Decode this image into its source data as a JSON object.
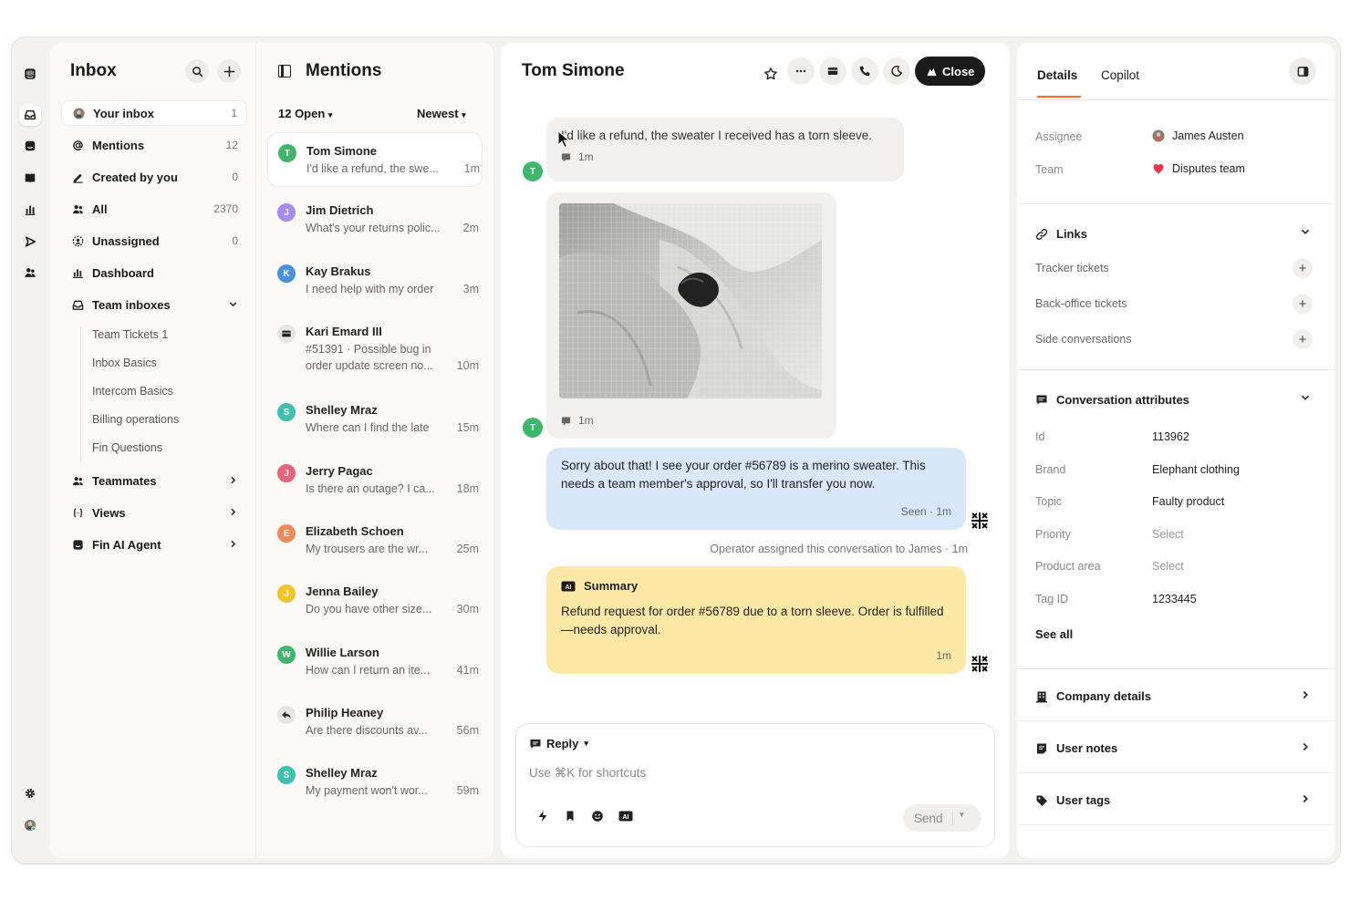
{
  "inbox": {
    "title": "Inbox",
    "nav": [
      {
        "label": "Your inbox",
        "count": "1"
      },
      {
        "label": "Mentions",
        "count": "12"
      },
      {
        "label": "Created by you",
        "count": "0"
      },
      {
        "label": "All",
        "count": "2370"
      },
      {
        "label": "Unassigned",
        "count": "0"
      },
      {
        "label": "Dashboard",
        "count": ""
      },
      {
        "label": "Team inboxes",
        "count": ""
      }
    ],
    "team_inboxes": [
      "Team Tickets 1",
      "Inbox Basics",
      "Intercom Basics",
      "Billing operations",
      "Fin Questions"
    ],
    "more": [
      {
        "label": "Teammates"
      },
      {
        "label": "Views"
      },
      {
        "label": "Fin AI Agent"
      }
    ]
  },
  "mentions": {
    "title": "Mentions",
    "filter_open": "12 Open",
    "filter_sort": "Newest",
    "items": [
      {
        "initial": "T",
        "name": "Tom Simone",
        "preview": "I'd like a refund, the swe...",
        "time": "1m",
        "color": "#3db86b"
      },
      {
        "initial": "J",
        "name": "Jim Dietrich",
        "preview": "What's your returns polic...",
        "time": "2m",
        "color": "#a78bf0"
      },
      {
        "initial": "K",
        "name": "Kay Brakus",
        "preview": "I need help with my order",
        "time": "3m",
        "color": "#4a8fe0"
      },
      {
        "initial": "",
        "name": "Kari Emard III",
        "preview": "#51391 · Possible bug in",
        "preview2": "order update screen no...",
        "time": "10m",
        "color": "#e7e5e1"
      },
      {
        "initial": "S",
        "name": "Shelley Mraz",
        "preview": "Where can I find the late",
        "time": "15m",
        "color": "#3fc0b0"
      },
      {
        "initial": "J",
        "name": "Jerry Pagac",
        "preview": "Is there an outage? I ca...",
        "time": "18m",
        "color": "#e8647a"
      },
      {
        "initial": "E",
        "name": "Elizabeth Schoen",
        "preview": "My trousers are the wr...",
        "time": "25m",
        "color": "#f08a5d"
      },
      {
        "initial": "J",
        "name": "Jenna Bailey",
        "preview": "Do you have other size...",
        "time": "30m",
        "color": "#f2c230"
      },
      {
        "initial": "W",
        "name": "Willie Larson",
        "preview": "How can I return an ite...",
        "time": "41m",
        "color": "#3db86b"
      },
      {
        "initial": "",
        "name": "Philip Heaney",
        "preview": "Are there discounts av...",
        "time": "56m",
        "color": "#e7e5e1"
      },
      {
        "initial": "S",
        "name": "Shelley Mraz",
        "preview": "My payment won't wor...",
        "time": "59m",
        "color": "#3fc0b0"
      }
    ]
  },
  "conversation": {
    "title": "Tom Simone",
    "close_label": "Close",
    "user_initial": "T",
    "msg1_text": "I'd like a refund, the sweater I received has a torn sleeve.",
    "msg1_time": "1m",
    "msg2_time": "1m",
    "msg3_text": "Sorry about that! I see your order #56789 is a merino sweater. This needs a team member's approval, so I'll transfer you now.",
    "msg3_meta": "Seen · 1m",
    "system_note": "Operator assigned this conversation to James · 1m",
    "summary_title": "Summary",
    "summary_text": "Refund request for order #56789 due to a torn sleeve. Order is fulfilled—needs approval.",
    "summary_time": "1m",
    "composer": {
      "mode": "Reply",
      "placeholder": "Use ⌘K for shortcuts",
      "send_label": "Send"
    }
  },
  "details": {
    "tabs": [
      "Details",
      "Copilot"
    ],
    "assignee_label": "Assignee",
    "assignee_value": "James Austen",
    "team_label": "Team",
    "team_value": "Disputes team",
    "links_title": "Links",
    "links": [
      "Tracker tickets",
      "Back-office tickets",
      "Side conversations"
    ],
    "attributes_title": "Conversation attributes",
    "attributes": [
      {
        "label": "Id",
        "value": "113962",
        "placeholder": false
      },
      {
        "label": "Brand",
        "value": "Elephant clothing",
        "placeholder": false
      },
      {
        "label": "Topic",
        "value": "Faulty product",
        "placeholder": false
      },
      {
        "label": "Priority",
        "value": "Select",
        "placeholder": true
      },
      {
        "label": "Product area",
        "value": "Select",
        "placeholder": true
      },
      {
        "label": "Tag ID",
        "value": "1233445",
        "placeholder": false
      }
    ],
    "see_all": "See all",
    "sections": [
      "Company details",
      "User notes",
      "User tags"
    ]
  },
  "colors": {
    "accent": "#ff6a2b",
    "user_bubble": "#f1f0ee",
    "admin_bubble": "#d9e7fb",
    "summary_bubble": "#fde8a6",
    "close_button": "#1a1a1a"
  },
  "icons": [
    "inbox-icon",
    "search-icon",
    "plus-icon",
    "at-icon",
    "pencil-icon",
    "people-icon",
    "dashboard-icon",
    "star-icon",
    "more-icon",
    "phone-icon",
    "close-ticket-icon",
    "fin-ai-icon",
    "chevron-down-icon",
    "chevron-right-icon",
    "link-icon",
    "flag-icon",
    "building-icon",
    "note-icon",
    "tag-icon"
  ]
}
